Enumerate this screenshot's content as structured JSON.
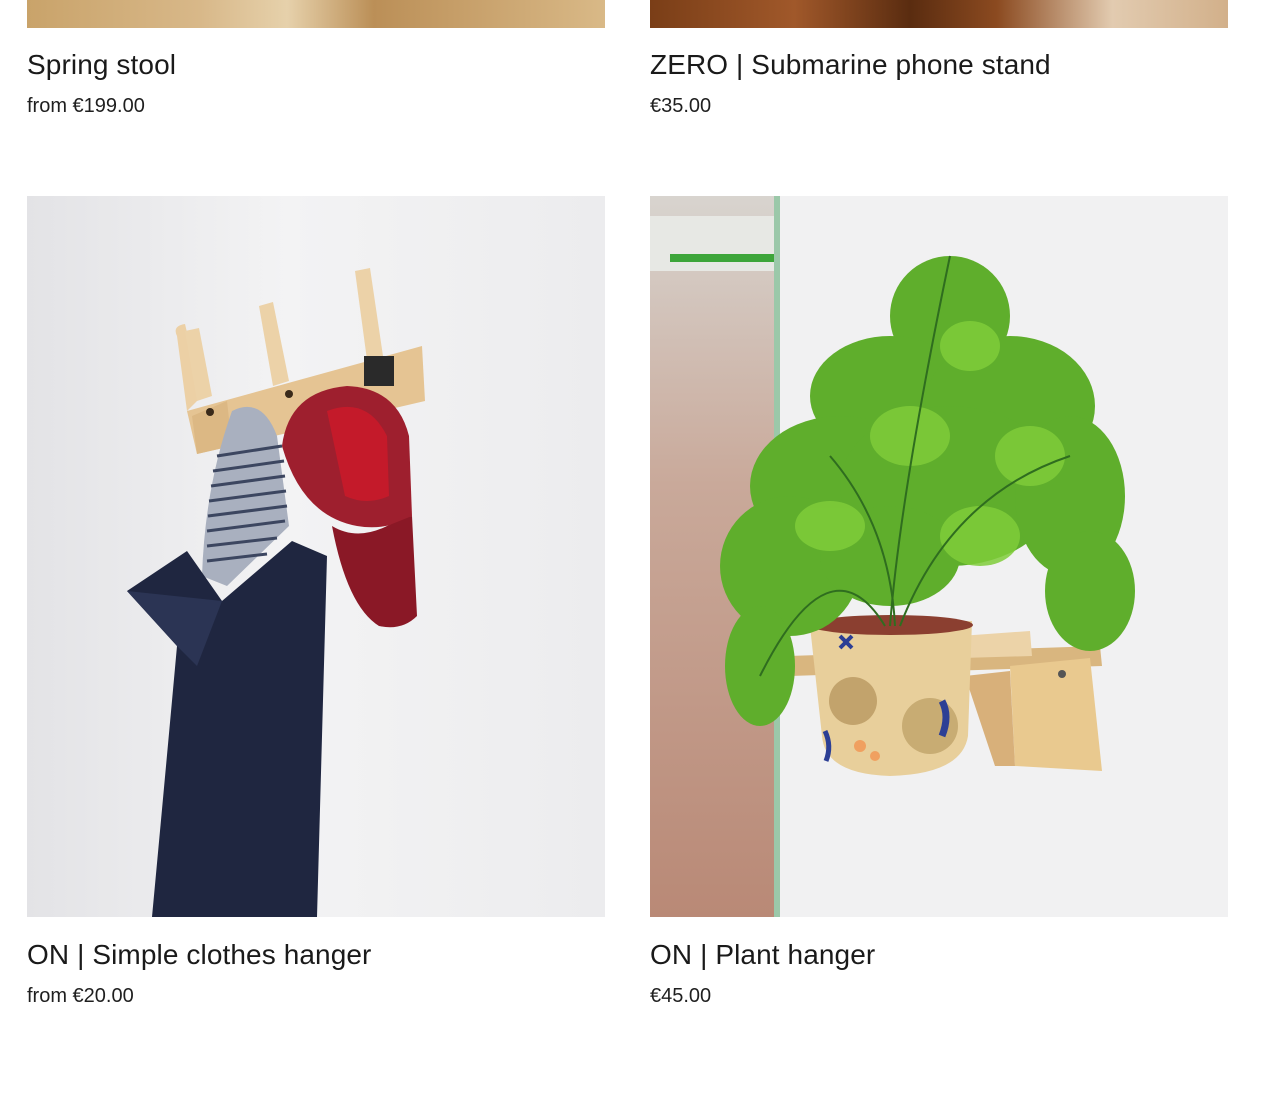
{
  "products": [
    {
      "title": "Spring stool",
      "price": "from €199.00",
      "image_icon": "stool-photo"
    },
    {
      "title": "ZERO | Submarine phone stand",
      "price": "€35.00",
      "image_icon": "phone-stand-photo"
    },
    {
      "title": "ON | Simple clothes hanger",
      "price": "from €20.00",
      "image_icon": "clothes-hanger-photo"
    },
    {
      "title": "ON | Plant hanger",
      "price": "€45.00",
      "image_icon": "plant-hanger-photo"
    }
  ],
  "colors": {
    "text": "#1a1a1a",
    "background": "#ffffff",
    "plywood": "#e8c796",
    "cap_red": "#9e1f2e",
    "jacket_navy": "#1f2640",
    "fern_green": "#5fae2c"
  }
}
